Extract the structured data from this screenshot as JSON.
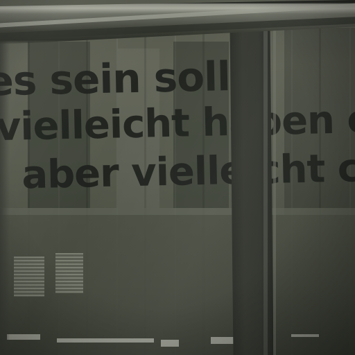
{
  "window_text": {
    "line_1": "es sein soll",
    "line_2": "vielleicht haben es e",
    "line_3": "aber vielleicht c"
  },
  "colors": {
    "text": "#1d201c",
    "glass": "#5c5f52",
    "pillar": "#33362f",
    "frame": "#a6a89c"
  }
}
